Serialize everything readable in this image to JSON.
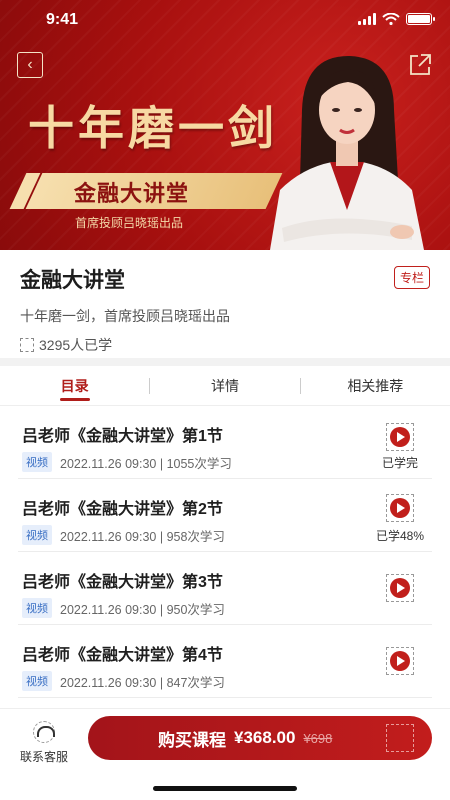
{
  "status_bar": {
    "time": "9:41"
  },
  "banner": {
    "headline": "十年磨一剑",
    "ribbon": "金融大讲堂",
    "sub": "首席投顾吕晓瑶出品"
  },
  "course": {
    "title": "金融大讲堂",
    "tag": "专栏",
    "desc": "十年磨一剑，首席投顾吕晓瑶出品",
    "learners": "3295人已学"
  },
  "tabs": [
    {
      "label": "目录",
      "active": true
    },
    {
      "label": "详情",
      "active": false
    },
    {
      "label": "相关推荐",
      "active": false
    }
  ],
  "lessons": [
    {
      "title": "吕老师《金融大讲堂》第1节",
      "badge": "视频",
      "meta": "2022.11.26 09:30 | 1055次学习",
      "status": "已学完"
    },
    {
      "title": "吕老师《金融大讲堂》第2节",
      "badge": "视频",
      "meta": "2022.11.26 09:30 | 958次学习",
      "status": "已学48%"
    },
    {
      "title": "吕老师《金融大讲堂》第3节",
      "badge": "视频",
      "meta": "2022.11.26 09:30 | 950次学习",
      "status": ""
    },
    {
      "title": "吕老师《金融大讲堂》第4节",
      "badge": "视频",
      "meta": "2022.11.26 09:30 | 847次学习",
      "status": ""
    }
  ],
  "bottom": {
    "service_label": "联系客服",
    "buy_label": "购买课程",
    "price": "¥368.00",
    "original_price": "¥698"
  },
  "colors": {
    "primary": "#b01d1a",
    "badge_bg": "#e6eefb",
    "badge_text": "#3a6fc4",
    "gold": "#f7d9a3"
  },
  "icons": [
    "back-icon",
    "share-icon",
    "person-icon",
    "play-icon",
    "headset-icon"
  ]
}
